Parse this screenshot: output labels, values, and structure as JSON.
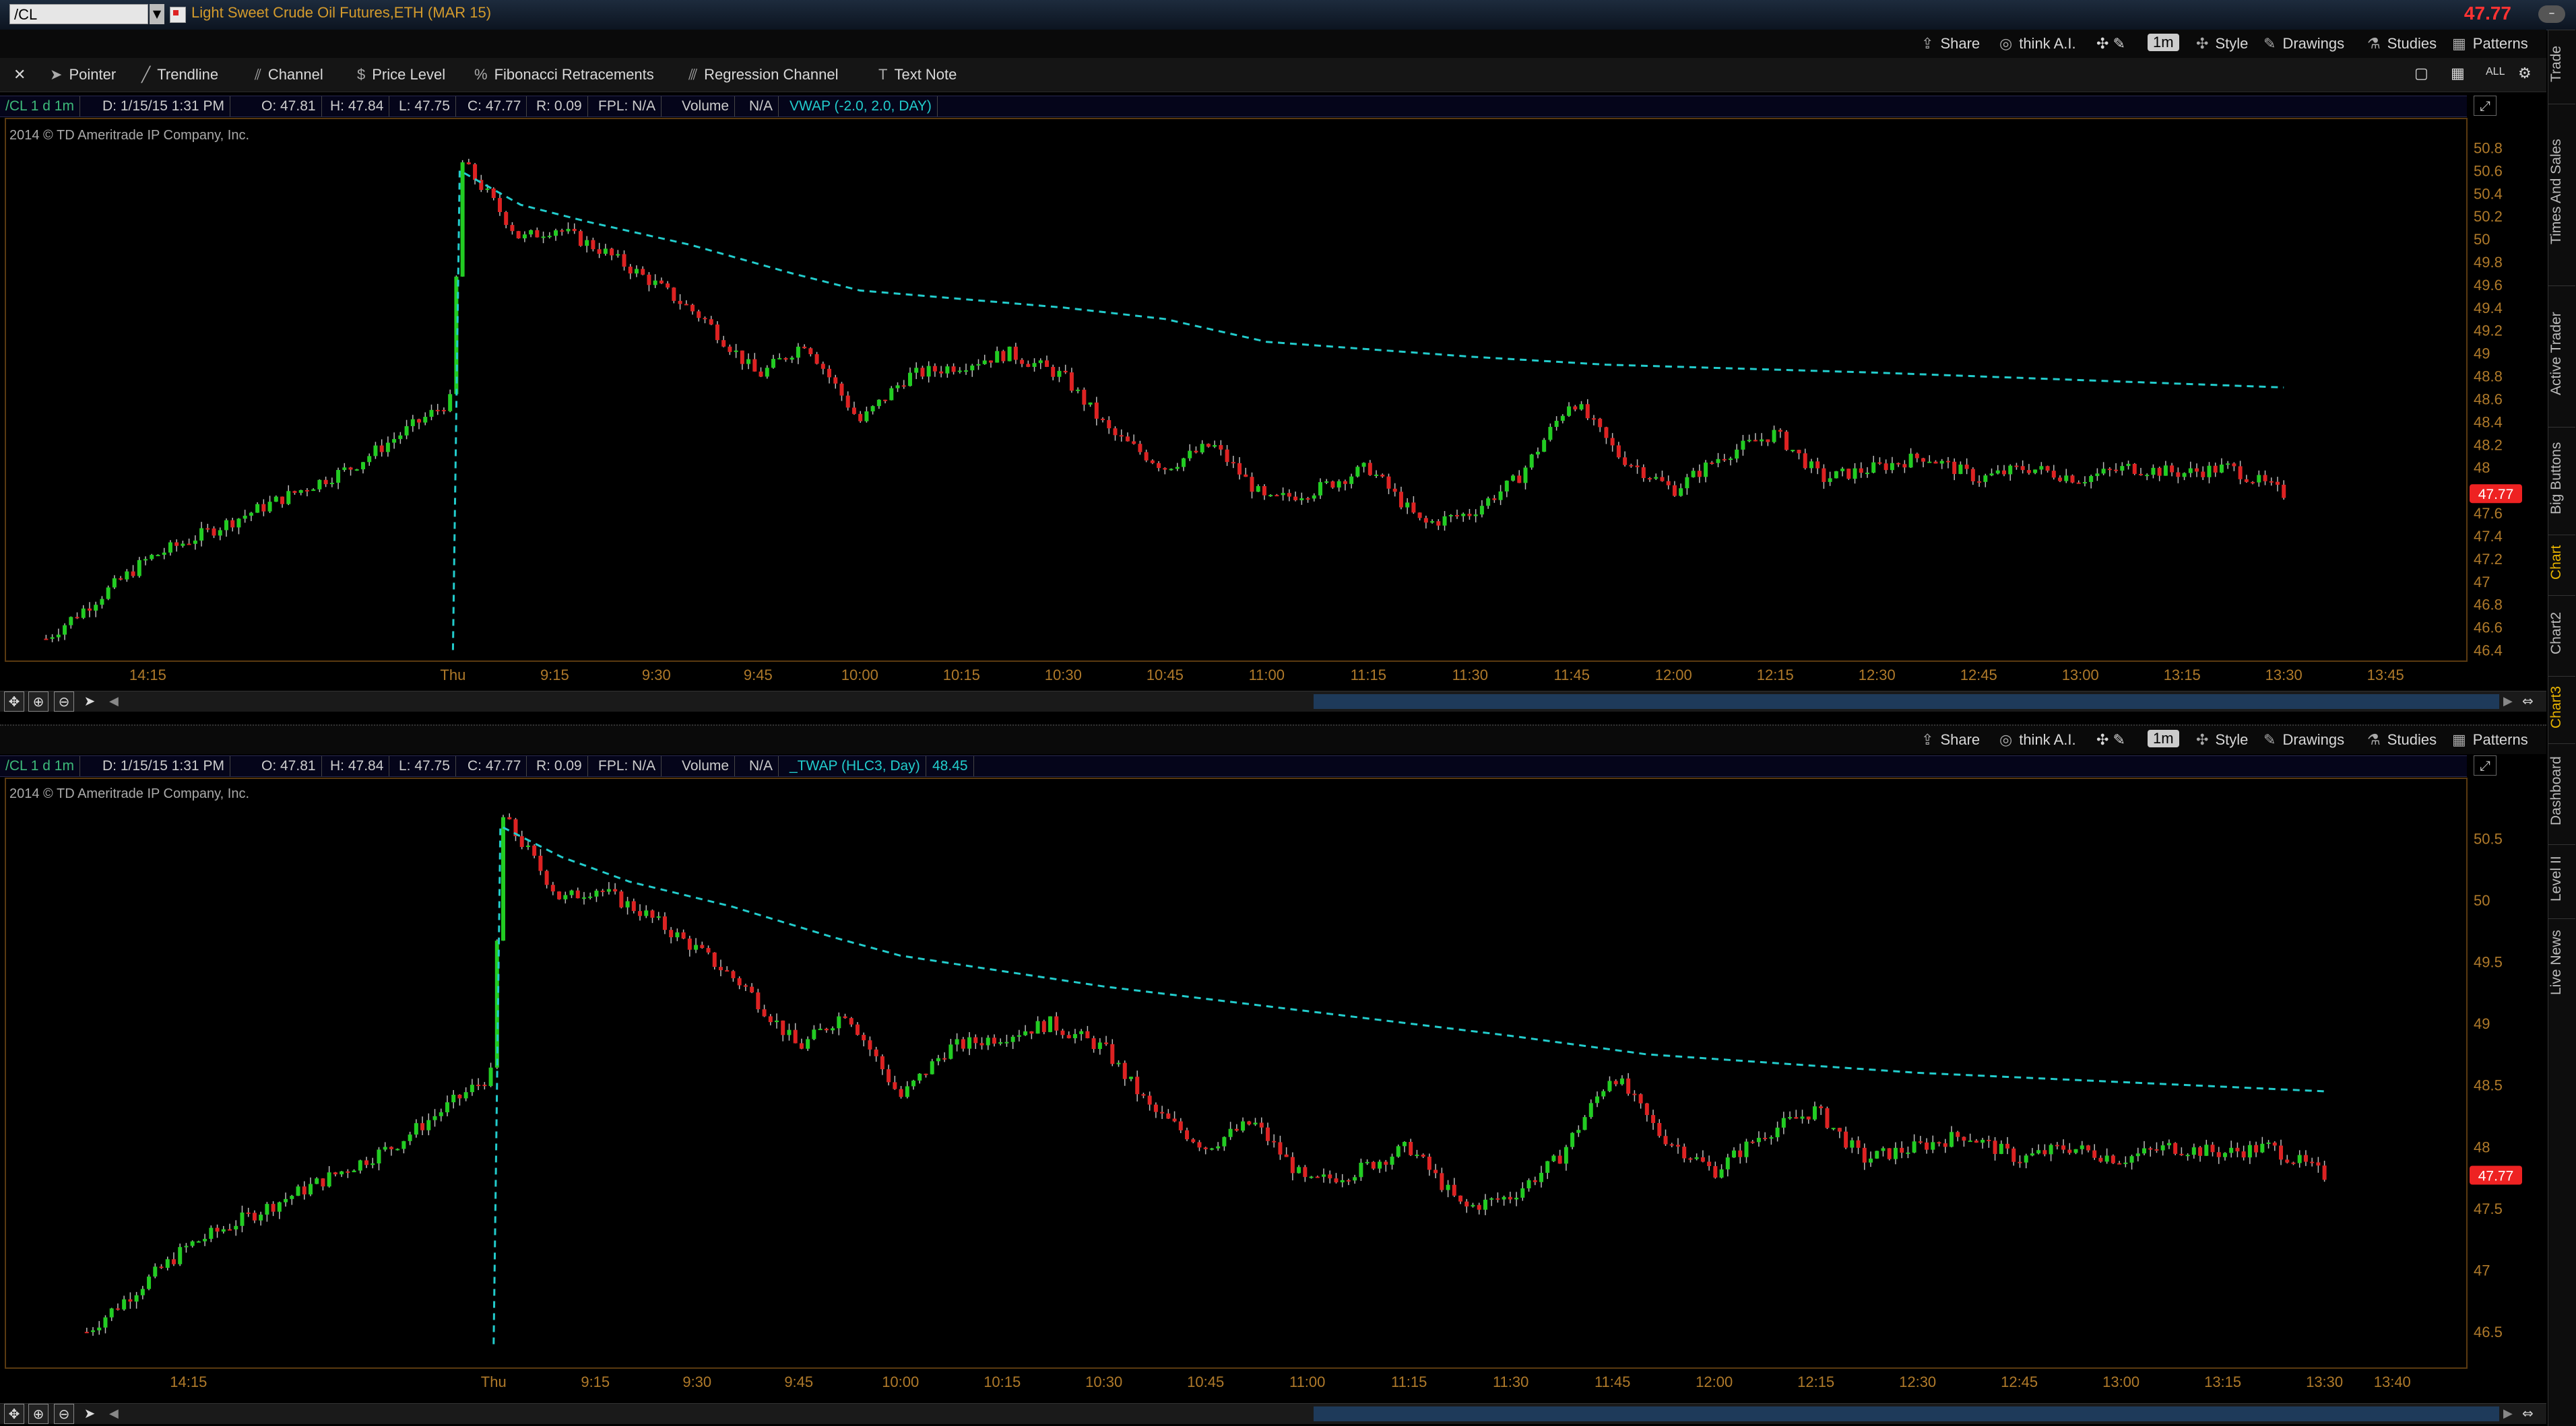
{
  "app": {
    "symbol_input": "/CL",
    "instrument_title": "Light Sweet Crude Oil Futures,ETH (MAR 15)",
    "last_price": "47.77"
  },
  "chart_header": {
    "share": "Share",
    "think_ai": "think A.I.",
    "aggregation": "1m",
    "style": "Style",
    "drawings": "Drawings",
    "studies": "Studies",
    "patterns": "Patterns"
  },
  "drawing_tools": [
    "Pointer",
    "Trendline",
    "Channel",
    "Price Level",
    "Fibonacci Retracements",
    "Regression Channel",
    "Text Note"
  ],
  "right_tabs": [
    "Trade",
    "Times And Sales",
    "Active Trader",
    "Big Buttons",
    "Chart",
    "Chart2",
    "Chart3",
    "Dashboard",
    "Level II",
    "Live News"
  ],
  "copyright": "2014 © TD Ameritrade IP Company, Inc.",
  "panel1": {
    "status": [
      "/CL 1 d 1m",
      "D: 1/15/15 1:31 PM",
      "O: 47.81",
      "H: 47.84",
      "L: 47.75",
      "C: 47.77",
      "R: 0.09",
      "FPL: N/A",
      "Volume",
      "N/A",
      "VWAP (-2.0, 2.0, DAY)"
    ]
  },
  "panel2": {
    "status": [
      "/CL 1 d 1m",
      "D: 1/15/15 1:31 PM",
      "O: 47.81",
      "H: 47.84",
      "L: 47.75",
      "C: 47.77",
      "R: 0.09",
      "FPL: N/A",
      "Volume",
      "N/A",
      "_TWAP (HLC3, Day)",
      "48.45"
    ]
  },
  "colors": {
    "up_candle": "#22cc22",
    "down_candle": "#dd2222",
    "average_line": "#22cccc",
    "axis_text": "#b07a2a",
    "price_badge": "#ee2222"
  },
  "chart_data": [
    {
      "type": "candlestick",
      "interval": "1m",
      "x_tick_labels": [
        "14:15",
        "Thu",
        "9:15",
        "9:30",
        "9:45",
        "10:00",
        "10:15",
        "10:30",
        "10:45",
        "11:00",
        "11:15",
        "11:30",
        "11:45",
        "12:00",
        "12:15",
        "12:30",
        "12:45",
        "13:00",
        "13:15",
        "13:30",
        "13:45"
      ],
      "y_tick_labels": [
        "50.8",
        "50.6",
        "50.4",
        "50.2",
        "50",
        "49.8",
        "49.6",
        "49.4",
        "49.2",
        "49",
        "48.8",
        "48.6",
        "48.4",
        "48.2",
        "48",
        "47.8",
        "47.6",
        "47.4",
        "47.2",
        "47",
        "46.8",
        "46.6",
        "46.4"
      ],
      "ylim": [
        46.35,
        50.95
      ],
      "last_price_label": "47.77",
      "price_path": [
        [
          "14:00",
          46.5
        ],
        [
          "14:15",
          47.2
        ],
        [
          "14:30",
          47.6
        ],
        [
          "14:45",
          48.0
        ],
        [
          "Thu",
          48.6
        ],
        [
          "9:01",
          50.7
        ],
        [
          "9:05",
          50.4
        ],
        [
          "9:10",
          50.0
        ],
        [
          "9:15",
          50.1
        ],
        [
          "9:22",
          49.9
        ],
        [
          "9:30",
          49.6
        ],
        [
          "9:37",
          49.3
        ],
        [
          "9:45",
          48.8
        ],
        [
          "9:52",
          49.1
        ],
        [
          "10:00",
          48.4
        ],
        [
          "10:07",
          48.8
        ],
        [
          "10:15",
          48.9
        ],
        [
          "10:22",
          49.0
        ],
        [
          "10:30",
          48.8
        ],
        [
          "10:37",
          48.3
        ],
        [
          "10:45",
          48.0
        ],
        [
          "10:52",
          48.2
        ],
        [
          "11:00",
          47.7
        ],
        [
          "11:07",
          47.8
        ],
        [
          "11:15",
          48.0
        ],
        [
          "11:23",
          47.5
        ],
        [
          "11:30",
          47.6
        ],
        [
          "11:37",
          47.9
        ],
        [
          "11:45",
          48.6
        ],
        [
          "11:52",
          48.1
        ],
        [
          "12:00",
          47.8
        ],
        [
          "12:07",
          48.1
        ],
        [
          "12:15",
          48.3
        ],
        [
          "12:22",
          47.9
        ],
        [
          "12:30",
          48.0
        ],
        [
          "12:37",
          48.1
        ],
        [
          "12:45",
          47.9
        ],
        [
          "12:52",
          48.0
        ],
        [
          "13:00",
          47.9
        ],
        [
          "13:07",
          48.0
        ],
        [
          "13:15",
          47.95
        ],
        [
          "13:22",
          48.0
        ],
        [
          "13:30",
          47.77
        ]
      ],
      "studies": [
        {
          "name": "VWAP (-2.0, 2.0, DAY)",
          "style": "dashed",
          "points": [
            [
              "Thu",
              46.4
            ],
            [
              "9:01",
              50.6
            ],
            [
              "9:10",
              50.3
            ],
            [
              "9:20",
              50.15
            ],
            [
              "9:35",
              49.95
            ],
            [
              "9:50",
              49.7
            ],
            [
              "10:00",
              49.55
            ],
            [
              "10:30",
              49.4
            ],
            [
              "10:45",
              49.3
            ],
            [
              "11:00",
              49.1
            ],
            [
              "11:30",
              48.97
            ],
            [
              "11:50",
              48.9
            ],
            [
              "12:30",
              48.83
            ],
            [
              "13:30",
              48.7
            ]
          ]
        }
      ]
    },
    {
      "type": "candlestick",
      "interval": "1m",
      "x_tick_labels": [
        "14:15",
        "Thu",
        "9:15",
        "9:30",
        "9:45",
        "10:00",
        "10:15",
        "10:30",
        "10:45",
        "11:00",
        "11:15",
        "11:30",
        "11:45",
        "12:00",
        "12:15",
        "12:30",
        "12:45",
        "13:00",
        "13:15",
        "13:30",
        "13:40"
      ],
      "y_tick_labels": [
        "50.5",
        "50",
        "49.5",
        "49",
        "48.5",
        "48",
        "47.5",
        "47",
        "46.5"
      ],
      "ylim": [
        46.25,
        50.9
      ],
      "last_price_label": "47.77",
      "price_path": [
        [
          "14:00",
          46.5
        ],
        [
          "14:15",
          47.2
        ],
        [
          "14:30",
          47.6
        ],
        [
          "14:45",
          48.0
        ],
        [
          "Thu",
          48.6
        ],
        [
          "9:01",
          50.7
        ],
        [
          "9:05",
          50.4
        ],
        [
          "9:10",
          50.0
        ],
        [
          "9:15",
          50.1
        ],
        [
          "9:22",
          49.9
        ],
        [
          "9:30",
          49.6
        ],
        [
          "9:37",
          49.3
        ],
        [
          "9:45",
          48.8
        ],
        [
          "9:52",
          49.1
        ],
        [
          "10:00",
          48.4
        ],
        [
          "10:07",
          48.8
        ],
        [
          "10:15",
          48.9
        ],
        [
          "10:22",
          49.0
        ],
        [
          "10:30",
          48.8
        ],
        [
          "10:37",
          48.3
        ],
        [
          "10:45",
          48.0
        ],
        [
          "10:52",
          48.2
        ],
        [
          "11:00",
          47.7
        ],
        [
          "11:07",
          47.8
        ],
        [
          "11:15",
          48.0
        ],
        [
          "11:23",
          47.5
        ],
        [
          "11:30",
          47.6
        ],
        [
          "11:37",
          47.9
        ],
        [
          "11:45",
          48.6
        ],
        [
          "11:52",
          48.1
        ],
        [
          "12:00",
          47.8
        ],
        [
          "12:07",
          48.1
        ],
        [
          "12:15",
          48.3
        ],
        [
          "12:22",
          47.9
        ],
        [
          "12:30",
          48.0
        ],
        [
          "12:37",
          48.1
        ],
        [
          "12:45",
          47.9
        ],
        [
          "12:52",
          48.0
        ],
        [
          "13:00",
          47.9
        ],
        [
          "13:07",
          48.0
        ],
        [
          "13:15",
          47.95
        ],
        [
          "13:22",
          48.0
        ],
        [
          "13:30",
          47.77
        ]
      ],
      "studies": [
        {
          "name": "_TWAP (HLC3, Day)",
          "style": "dashed",
          "last_value": 48.45,
          "points": [
            [
              "Thu",
              46.4
            ],
            [
              "9:01",
              50.6
            ],
            [
              "9:10",
              50.35
            ],
            [
              "9:20",
              50.15
            ],
            [
              "9:35",
              49.95
            ],
            [
              "9:50",
              49.7
            ],
            [
              "10:00",
              49.55
            ],
            [
              "10:30",
              49.3
            ],
            [
              "11:00",
              49.1
            ],
            [
              "11:30",
              48.9
            ],
            [
              "11:50",
              48.75
            ],
            [
              "12:30",
              48.6
            ],
            [
              "13:30",
              48.45
            ]
          ]
        }
      ]
    }
  ]
}
